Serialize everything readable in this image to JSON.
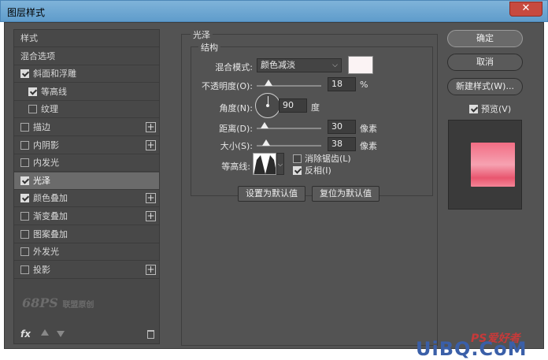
{
  "window": {
    "title": "图层样式",
    "close_label": "✕"
  },
  "left_panel": {
    "items": [
      {
        "label": "样式",
        "checkbox": null,
        "plus": false,
        "selected": false,
        "indent": 0
      },
      {
        "label": "混合选项",
        "checkbox": null,
        "plus": false,
        "selected": false,
        "indent": 0
      },
      {
        "label": "斜面和浮雕",
        "checkbox": true,
        "plus": false,
        "selected": false,
        "indent": 0
      },
      {
        "label": "等高线",
        "checkbox": true,
        "plus": false,
        "selected": false,
        "indent": 1
      },
      {
        "label": "纹理",
        "checkbox": false,
        "plus": false,
        "selected": false,
        "indent": 1
      },
      {
        "label": "描边",
        "checkbox": false,
        "plus": true,
        "selected": false,
        "indent": 0
      },
      {
        "label": "内阴影",
        "checkbox": false,
        "plus": true,
        "selected": false,
        "indent": 0
      },
      {
        "label": "内发光",
        "checkbox": false,
        "plus": false,
        "selected": false,
        "indent": 0
      },
      {
        "label": "光泽",
        "checkbox": true,
        "plus": false,
        "selected": true,
        "indent": 0
      },
      {
        "label": "颜色叠加",
        "checkbox": true,
        "plus": true,
        "selected": false,
        "indent": 0
      },
      {
        "label": "渐变叠加",
        "checkbox": false,
        "plus": true,
        "selected": false,
        "indent": 0
      },
      {
        "label": "图案叠加",
        "checkbox": false,
        "plus": false,
        "selected": false,
        "indent": 0
      },
      {
        "label": "外发光",
        "checkbox": false,
        "plus": false,
        "selected": false,
        "indent": 0
      },
      {
        "label": "投影",
        "checkbox": false,
        "plus": true,
        "selected": false,
        "indent": 0
      }
    ],
    "logo_text": "68PS",
    "logo_sub": "联盟原创",
    "fx_label": "fx"
  },
  "satin": {
    "group_title": "光泽",
    "struct_title": "结构",
    "blend_mode_label": "混合模式:",
    "blend_mode_value": "颜色减淡",
    "swatch_color": "#fbf3f4",
    "opacity_label": "不透明度(O):",
    "opacity_value": "18",
    "opacity_unit": "%",
    "opacity_level": 0.18,
    "angle_label": "角度(N):",
    "angle_value": "90",
    "angle_unit": "度",
    "distance_label": "距离(D):",
    "distance_value": "30",
    "distance_unit": "像素",
    "distance_level": 0.12,
    "size_label": "大小(S):",
    "size_value": "38",
    "size_unit": "像素",
    "size_level": 0.15,
    "contour_label": "等高线:",
    "antialias_label": "消除锯齿(L)",
    "antialias_checked": false,
    "invert_label": "反相(I)",
    "invert_checked": true,
    "make_default_label": "设置为默认值",
    "reset_default_label": "复位为默认值"
  },
  "right_panel": {
    "ok_label": "确定",
    "cancel_label": "取消",
    "new_style_label": "新建样式(W)...",
    "preview_label": "预览(V)",
    "preview_checked": true,
    "preview_color": "#f26d84"
  },
  "site_watermark": {
    "ps": "PS爱好者",
    "main": "UiBQ.CoM"
  }
}
